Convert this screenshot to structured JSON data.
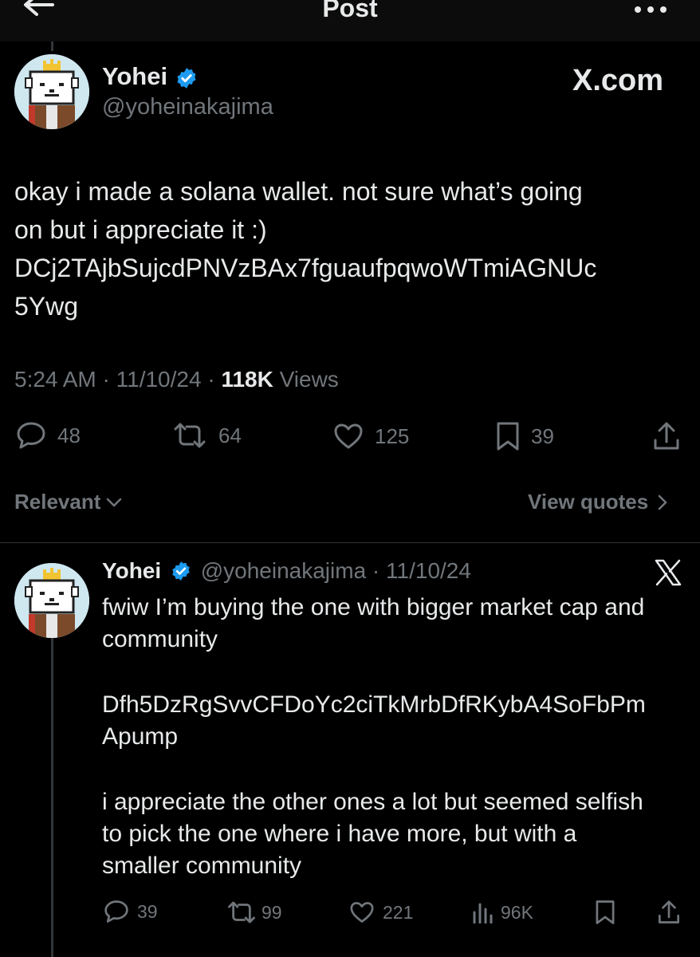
{
  "header": {
    "title": "Post"
  },
  "post": {
    "author_name": "Yohei",
    "author_handle": "@yoheinakajima",
    "brand_label": "X.com",
    "text_lines": [
      "okay i made a solana wallet.  not sure what’s going",
      "on but i appreciate it :)",
      "DCj2TAjbSujcdPNVzBAx7fguaufpqwoWTmiAGNUc",
      "5Ywg"
    ],
    "time": "5:24 AM",
    "date": "11/10/24",
    "views_count": "118K",
    "views_label": "Views",
    "separator": "·",
    "stats": {
      "replies": "48",
      "reposts": "64",
      "likes": "125",
      "bookmarks": "39"
    }
  },
  "sort": {
    "relevant_label": "Relevant",
    "view_quotes_label": "View quotes"
  },
  "reply": {
    "author_name": "Yohei",
    "author_handle": "@yoheinakajima",
    "separator": "·",
    "date": "11/10/24",
    "para1": [
      "fwiw I’m buying the one with bigger market cap and",
      "community"
    ],
    "para2": [
      "Dfh5DzRgSvvCFDoYc2ciTkMrbDfRKybA4SoFbPm",
      "Apump"
    ],
    "para3": [
      "i appreciate the other ones a lot but seemed selfish",
      "to pick the one where i have more, but with a",
      "smaller community"
    ],
    "stats": {
      "replies": "39",
      "reposts": "99",
      "likes": "221",
      "views": "96K"
    }
  },
  "colors": {
    "background": "#000000",
    "text": "#e7e9ea",
    "muted": "#71767b",
    "verified": "#1d9bf0",
    "divider": "#2f3336"
  }
}
